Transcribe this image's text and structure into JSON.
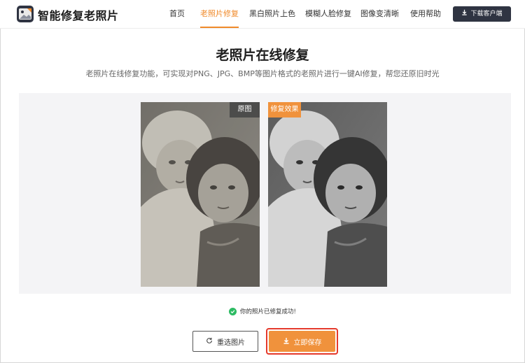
{
  "app": {
    "brand": "智能修复老照片",
    "nav": [
      {
        "label": "首页"
      },
      {
        "label": "老照片修复"
      },
      {
        "label": "黑白照片上色"
      },
      {
        "label": "模糊人脸修复"
      },
      {
        "label": "图像变清晰"
      },
      {
        "label": "使用帮助"
      }
    ],
    "download_label": "下载客户端"
  },
  "hero": {
    "title": "老照片在线修复",
    "subtitle": "老照片在线修复功能，可实现对PNG、JPG、BMP等图片格式的老照片进行一键AI修复，帮您还原旧时光"
  },
  "preview": {
    "original_tag": "原图",
    "result_tag": "修复效果"
  },
  "status": {
    "success_text": "你的照片已修复成功!"
  },
  "actions": {
    "reselect_label": "重选图片",
    "save_label": "立即保存"
  },
  "colors": {
    "accent": "#f08a2a",
    "dark": "#2f3442",
    "success": "#2dbb63",
    "highlight_border": "#e5392b"
  },
  "icons": {
    "logo": "photo-logo-icon",
    "download": "download-icon",
    "check": "check-circle-icon",
    "refresh": "refresh-icon",
    "save": "download-icon"
  }
}
